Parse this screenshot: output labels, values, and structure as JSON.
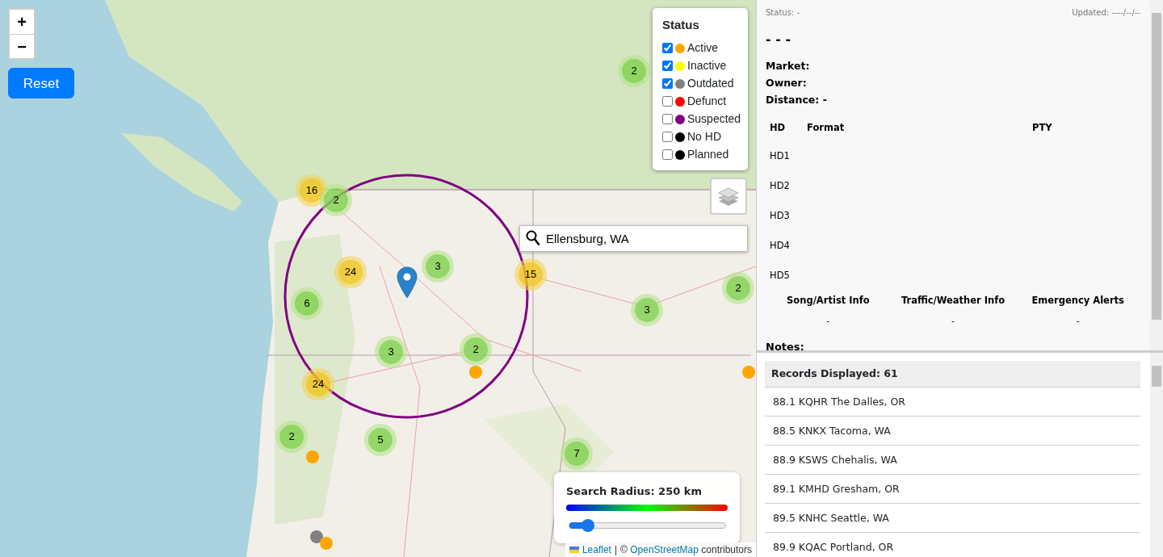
{
  "map": {
    "zoom_in": "+",
    "zoom_out": "−",
    "reset": "Reset",
    "legend": {
      "title": "Status",
      "items": [
        {
          "label": "Active",
          "checked": true,
          "color": "#ffa500"
        },
        {
          "label": "Inactive",
          "checked": true,
          "color": "#ffff00"
        },
        {
          "label": "Outdated",
          "checked": true,
          "color": "#808080"
        },
        {
          "label": "Defunct",
          "checked": false,
          "color": "#ff0000"
        },
        {
          "label": "Suspected",
          "checked": false,
          "color": "#800080"
        },
        {
          "label": "No HD",
          "checked": false,
          "color": "#000000"
        },
        {
          "label": "Planned",
          "checked": false,
          "color": "#000000"
        }
      ]
    },
    "search": {
      "value": "Ellensburg, WA"
    },
    "clusters": [
      {
        "count": "2",
        "kind": "small"
      },
      {
        "count": "16",
        "kind": "large"
      },
      {
        "count": "2",
        "kind": "small"
      },
      {
        "count": "24",
        "kind": "large"
      },
      {
        "count": "3",
        "kind": "small"
      },
      {
        "count": "15",
        "kind": "large"
      },
      {
        "count": "6",
        "kind": "small"
      },
      {
        "count": "2",
        "kind": "small"
      },
      {
        "count": "3",
        "kind": "small"
      },
      {
        "count": "3",
        "kind": "small"
      },
      {
        "count": "2",
        "kind": "small"
      },
      {
        "count": "24",
        "kind": "large"
      },
      {
        "count": "2",
        "kind": "small"
      },
      {
        "count": "5",
        "kind": "small"
      },
      {
        "count": "7",
        "kind": "small"
      }
    ],
    "markers": [
      {
        "color": "#ffa500"
      },
      {
        "color": "#ffa500"
      },
      {
        "color": "#ffa500"
      },
      {
        "color": "#808080"
      },
      {
        "color": "#ffa500"
      }
    ],
    "radius": {
      "label": "Search Radius: 250 km",
      "level": 0.12
    },
    "attribution": {
      "leaflet": "Leaflet",
      "separator": "|",
      "prefix": "©",
      "link": "OpenStreetMap",
      "suffix": "contributors"
    }
  },
  "details": {
    "status": "Status: -",
    "updated": "Updated: ----/--/--",
    "title": "- - -",
    "fields": [
      {
        "label": "Market:"
      },
      {
        "label": "Owner:"
      },
      {
        "label": "Distance:",
        "value": "-"
      }
    ],
    "hd_table": {
      "columns": [
        "HD",
        "Format",
        "PTY"
      ],
      "rows": [
        "HD1",
        "HD2",
        "HD3",
        "HD4",
        "HD5"
      ]
    },
    "features": [
      {
        "label": "Song/Artist Info",
        "value": "-"
      },
      {
        "label": "Traffic/Weather Info",
        "value": "-"
      },
      {
        "label": "Emergency Alerts",
        "value": "-"
      }
    ],
    "notes_label": "Notes:"
  },
  "records": {
    "header": "Records Displayed: 61",
    "items": [
      "88.1 KQHR The Dalles, OR",
      "88.5 KNKX Tacoma, WA",
      "88.9 KSWS Chehalis, WA",
      "89.1 KMHD Gresham, OR",
      "89.5 KNHC Seattle, WA",
      "89.9 KQAC Portland, OR"
    ]
  }
}
